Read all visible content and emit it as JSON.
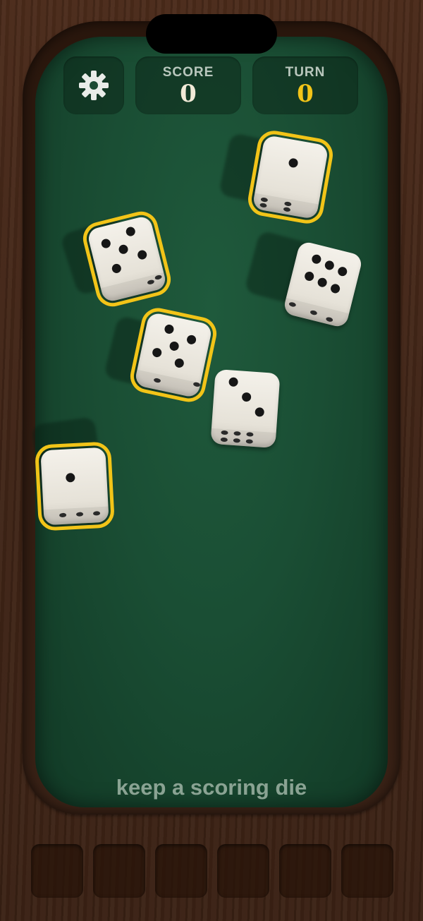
{
  "hud": {
    "settings_icon": "gear-icon",
    "score_label": "SCORE",
    "score_value": "0",
    "turn_label": "TURN",
    "turn_value": "0"
  },
  "dice": [
    {
      "id": "die-1",
      "top_face": 1,
      "kept": true
    },
    {
      "id": "die-2",
      "top_face": 5,
      "kept": true
    },
    {
      "id": "die-3",
      "top_face": 6,
      "kept": false
    },
    {
      "id": "die-4",
      "top_face": 5,
      "kept": true
    },
    {
      "id": "die-5",
      "top_face": 3,
      "kept": false
    },
    {
      "id": "die-6",
      "top_face": 1,
      "kept": true
    }
  ],
  "prompt": "keep a scoring die",
  "held_slots_count": 6,
  "colors": {
    "felt": "#1a4e34",
    "highlight": "#f2c418",
    "wood": "#4a2a1a"
  }
}
